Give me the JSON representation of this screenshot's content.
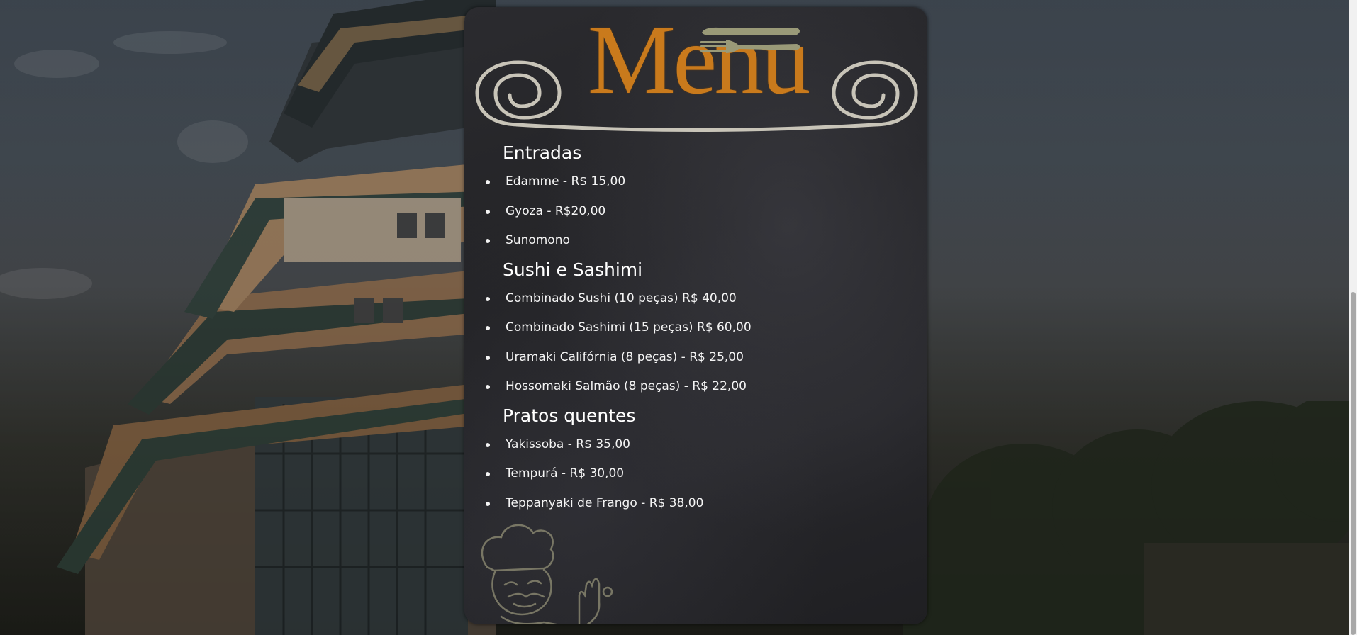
{
  "menu": {
    "title": "Menu",
    "sections": [
      {
        "title": "Entradas",
        "items": [
          "Edamme - R$ 15,00",
          "Gyoza - R$20,00",
          "Sunomono"
        ]
      },
      {
        "title": "Sushi e Sashimi",
        "items": [
          "Combinado Sushi (10 peças) R$ 40,00",
          "Combinado Sashimi (15 peças) R$ 60,00",
          "Uramaki Califórnia (8 peças) - R$ 25,00",
          "Hossomaki Salmão (8 peças) - R$ 22,00"
        ]
      },
      {
        "title": "Pratos quentes",
        "items": [
          "Yakissoba - R$ 35,00",
          "Tempurá - R$ 30,00",
          "Teppanyaki de Frango - R$ 38,00"
        ]
      }
    ]
  },
  "icons": {
    "header_decoration": "cutlery-icon",
    "swirls": "swirl-icon",
    "illustration": "chef-illustration"
  },
  "colors": {
    "title": "#c97a1c",
    "board": "#252528",
    "text": "#f4f4f4",
    "ornament": "#c8c4b8",
    "cutlery": "#9a9a78"
  }
}
